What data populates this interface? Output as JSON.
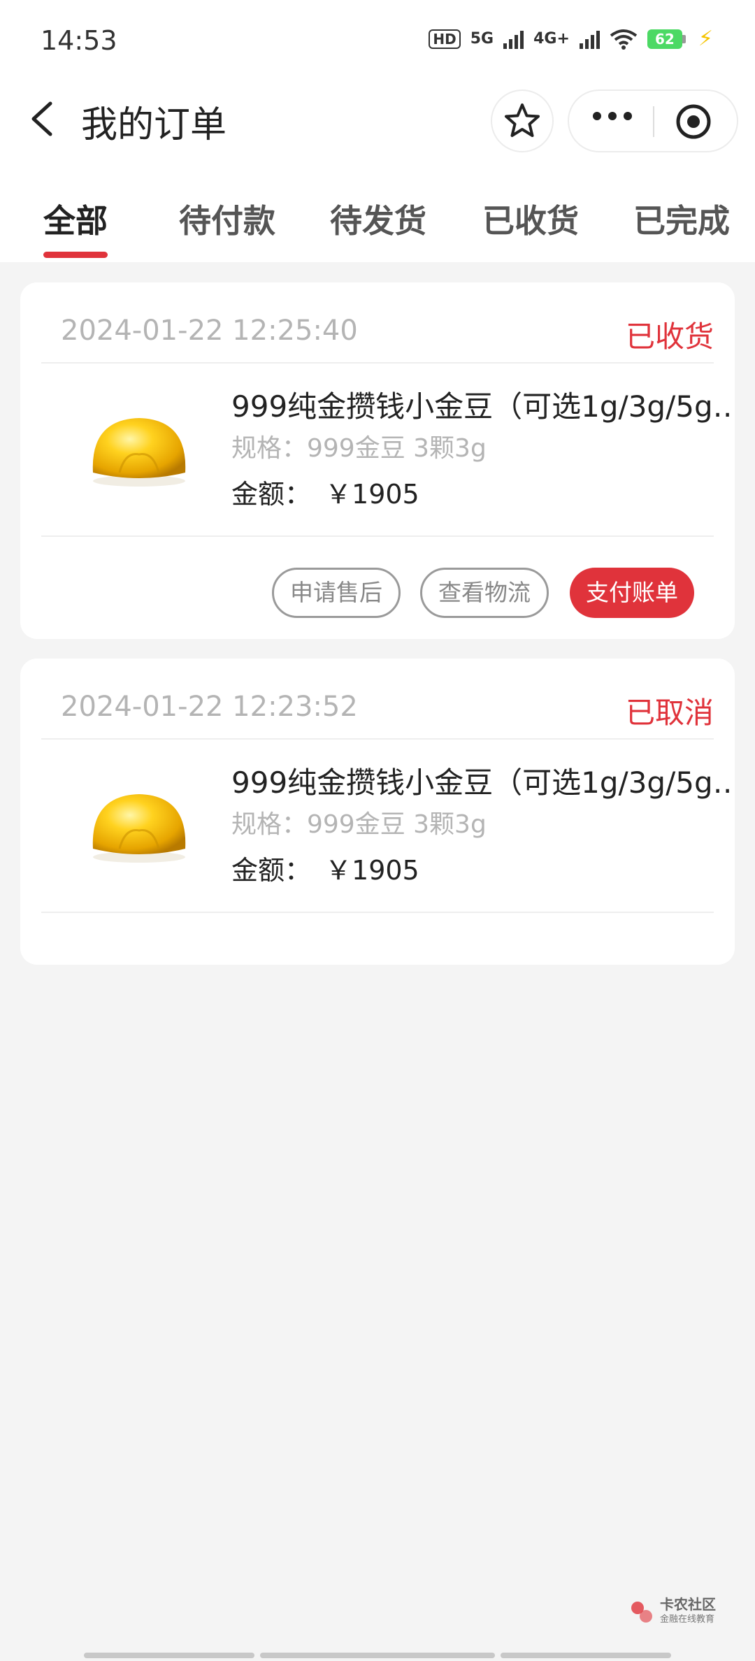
{
  "status_bar": {
    "time": "14:53",
    "hd": "HD",
    "sim1_type": "5G",
    "sim2_type": "4G+",
    "battery": "62"
  },
  "nav": {
    "title": "我的订单",
    "icons": [
      "back-icon",
      "star-icon",
      "more-icon",
      "target-icon"
    ]
  },
  "tabs": [
    {
      "label": "全部",
      "active": true
    },
    {
      "label": "待付款"
    },
    {
      "label": "待发货"
    },
    {
      "label": "已收货"
    },
    {
      "label": "已完成"
    }
  ],
  "orders": [
    {
      "time": "2024-01-22 12:25:40",
      "status": "已收货",
      "product_name": "999纯金攒钱小金豆（可选1g/3g/5g…",
      "spec": "规格：999金豆 3颗3g",
      "amount_label": "金额：",
      "amount_value": "￥1905",
      "buttons": [
        "申请售后",
        "查看物流",
        "支付账单"
      ]
    },
    {
      "time": "2024-01-22 12:23:52",
      "status": "已取消",
      "product_name": "999纯金攒钱小金豆（可选1g/3g/5g…",
      "spec": "规格：999金豆 3颗3g",
      "amount_label": "金额：",
      "amount_value": "￥1905"
    }
  ],
  "watermark": {
    "title": "卡农社区",
    "subtitle": "金融在线教育"
  },
  "colors": {
    "accent": "#e0333b",
    "background": "#f4f4f4",
    "muted_text": "#b4b4b4"
  }
}
